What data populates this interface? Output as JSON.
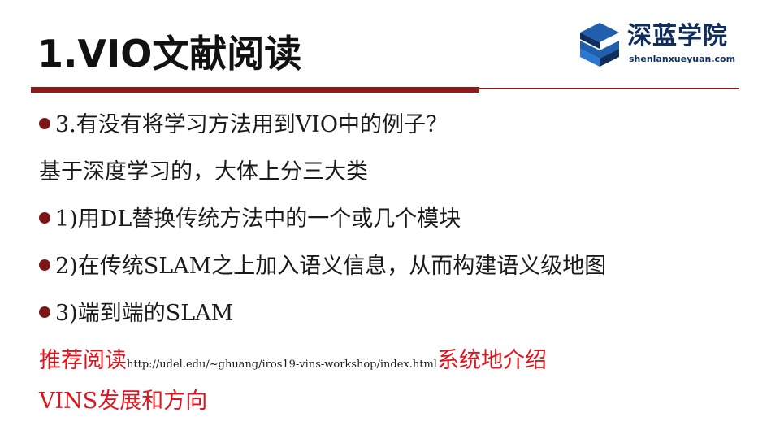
{
  "slide": {
    "title": "1.VIO文献阅读",
    "logo": {
      "name_cn": "深蓝学院",
      "domain": "shenlanxueyuan.com"
    },
    "lines": {
      "q": "3.有没有将学习方法用到VIO中的例子？",
      "intro": "基于深度学习的，大体上分三大类",
      "b1": "1)用DL替换传统方法中的一个或几个模块",
      "b2": "2)在传统SLAM之上加入语义信息，从而构建语义级地图",
      "b3": "3)端到端的SLAM"
    },
    "recommend": {
      "prefix": "推荐阅读",
      "url": "http://udel.edu/~ghuang/iros19-vins-workshop/index.html",
      "suffix": "系统地介绍",
      "line2": "VINS发展和方向"
    },
    "colors": {
      "accent": "#8b1d1d",
      "bullet": "#7a1616",
      "highlight": "#e0141e",
      "logo": "#0f2e5e"
    }
  }
}
